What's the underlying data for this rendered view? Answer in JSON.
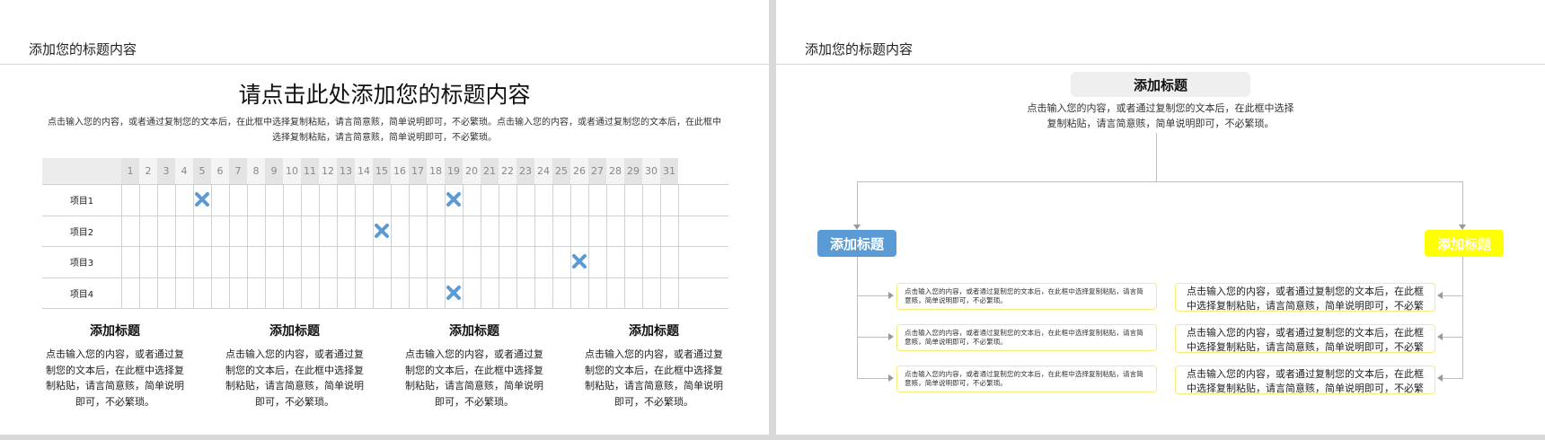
{
  "colors": {
    "accent_blue": "#5b9bd5",
    "accent_yellow": "#ffff00",
    "box_border_yellow": "#f5ec7a",
    "mark_blue": "#5b9bd5"
  },
  "left_slide": {
    "header": "添加您的标题内容",
    "big_title": "请点击此处添加您的标题内容",
    "intro": "点击输入您的内容，或者通过复制您的文本后，在此框中选择复制粘贴，请言简意赅，简单说明即可，不必繁琐。点击输入您的内容，或者通过复制您的文本后，在此框中选择复制粘贴，请言简意赅，简单说明即可，不必繁琐。",
    "grid": {
      "days": [
        "1",
        "2",
        "3",
        "4",
        "5",
        "6",
        "7",
        "8",
        "9",
        "10",
        "11",
        "12",
        "13",
        "14",
        "15",
        "16",
        "17",
        "18",
        "19",
        "20",
        "21",
        "22",
        "23",
        "24",
        "25",
        "26",
        "27",
        "28",
        "29",
        "30",
        "31"
      ],
      "rows": [
        {
          "label": "项目1",
          "marks": [
            5,
            19
          ]
        },
        {
          "label": "项目2",
          "marks": [
            15
          ]
        },
        {
          "label": "项目3",
          "marks": [
            26
          ]
        },
        {
          "label": "项目4",
          "marks": [
            19
          ]
        }
      ],
      "mark_icon": "x-mark-icon"
    },
    "columns": [
      {
        "title": "添加标题",
        "text": "点击输入您的内容，或者通过复制您的文本后，在此框中选择复制粘贴，请言简意赅，简单说明即可，不必繁琐。"
      },
      {
        "title": "添加标题",
        "text": "点击输入您的内容，或者通过复制您的文本后，在此框中选择复制粘贴，请言简意赅，简单说明即可，不必繁琐。"
      },
      {
        "title": "添加标题",
        "text": "点击输入您的内容，或者通过复制您的文本后，在此框中选择复制粘贴，请言简意赅，简单说明即可，不必繁琐。"
      },
      {
        "title": "添加标题",
        "text": "点击输入您的内容，或者通过复制您的文本后，在此框中选择复制粘贴，请言简意赅，简单说明即可，不必繁琐。"
      }
    ]
  },
  "right_slide": {
    "header": "添加您的标题内容",
    "top_title": "添加标题",
    "top_desc": "点击输入您的内容，或者通过复制您的文本后，在此框中选择复制粘贴，请言简意赅，简单说明即可，不必繁琐。",
    "left_tag": "添加标题",
    "right_tag": "添加标题",
    "left_boxes": [
      "点击输入您的内容，或者通过复制您的文本后，在此框中选择复制粘贴，请言简意赅，简单说明即可，不必繁琐。",
      "点击输入您的内容，或者通过复制您的文本后，在此框中选择复制粘贴，请言简意赅，简单说明即可，不必繁琐。",
      "点击输入您的内容，或者通过复制您的文本后，在此框中选择复制粘贴，请言简意赅，简单说明即可，不必繁琐。"
    ],
    "right_boxes": [
      "点击输入您的内容，或者通过复制您的文本后，在此框中选择复制粘贴，请言简意赅，简单说明即可，不必繁琐。",
      "点击输入您的内容，或者通过复制您的文本后，在此框中选择复制粘贴，请言简意赅，简单说明即可，不必繁琐。",
      "点击输入您的内容，或者通过复制您的文本后，在此框中选择复制粘贴，请言简意赅，简单说明即可，不必繁琐。"
    ]
  }
}
